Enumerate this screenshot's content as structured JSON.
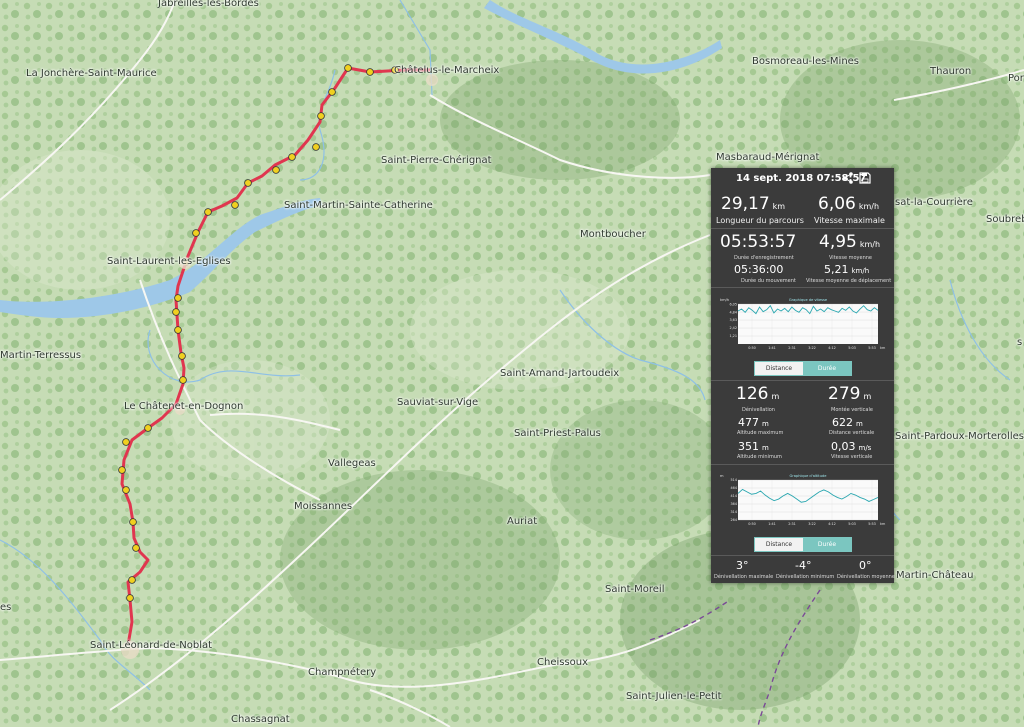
{
  "colors": {
    "map_bg": "#c9ddb9",
    "water": "#8ec0e6",
    "track": "#e0364f",
    "panel_bg": "#3b3b3b",
    "chart_line": "#8fe0e6",
    "accent": "#7bc6c0"
  },
  "places": [
    {
      "id": "jabreilles",
      "name": "Jabreilles-les-Bordes"
    },
    {
      "id": "jonchere",
      "name": "La Jonchère-Saint-Maurice"
    },
    {
      "id": "chatelus",
      "name": "Châtelus-le-Marcheix"
    },
    {
      "id": "bosmoreau",
      "name": "Bosmoreau-les-Mines"
    },
    {
      "id": "thauron",
      "name": "Thauron"
    },
    {
      "id": "por",
      "name": "Por"
    },
    {
      "id": "saint-pierre",
      "name": "Saint-Pierre-Chérignat"
    },
    {
      "id": "masbaraud",
      "name": "Masbaraud-Mérignat"
    },
    {
      "id": "martin-ste-cath",
      "name": "Saint-Martin-Sainte-Catherine"
    },
    {
      "id": "courriere",
      "name": "sat-la-Courrière"
    },
    {
      "id": "soubreb",
      "name": "Soubreb"
    },
    {
      "id": "montboucher",
      "name": "Montboucher"
    },
    {
      "id": "laurent",
      "name": "Saint-Laurent-les-Eglises"
    },
    {
      "id": "terressus",
      "name": "Martin-Terressus"
    },
    {
      "id": "amand",
      "name": "Saint-Amand-Jartoudeix"
    },
    {
      "id": "chatenet",
      "name": "Le Châtenet-en-Dognon"
    },
    {
      "id": "sauviat",
      "name": "Sauviat-sur-Vige"
    },
    {
      "id": "priest",
      "name": "Saint-Priest-Palus"
    },
    {
      "id": "pardoux",
      "name": "Saint-Pardoux-Morterolles"
    },
    {
      "id": "vallegeas",
      "name": "Vallegeas"
    },
    {
      "id": "moissannes",
      "name": "Moissannes"
    },
    {
      "id": "auriat",
      "name": "Auriat"
    },
    {
      "id": "martin-chateau",
      "name": "Martin-Château"
    },
    {
      "id": "moreil",
      "name": "Saint-Moreil"
    },
    {
      "id": "es",
      "name": "es"
    },
    {
      "id": "leonard",
      "name": "Saint-Léonard-de-Noblat"
    },
    {
      "id": "champnetery",
      "name": "Champnétery"
    },
    {
      "id": "cheissoux",
      "name": "Cheissoux"
    },
    {
      "id": "julien",
      "name": "Saint-Julien-le-Petit"
    },
    {
      "id": "chassagnat",
      "name": "Chassagnat"
    },
    {
      "id": "s-edge",
      "name": "s"
    }
  ],
  "panel": {
    "date": "14 sept. 2018 07:58:57",
    "distance": {
      "value": "29,17",
      "unit": "km",
      "label": "Longueur du parcours"
    },
    "max_speed": {
      "value": "6,06",
      "unit": "km/h",
      "label": "Vitesse maximale"
    },
    "duration": {
      "value": "05:53:57",
      "label": "Durée d'enregistrement"
    },
    "avg_speed": {
      "value": "4,95",
      "unit": "km/h",
      "label": "Vitesse moyenne"
    },
    "moving_time": {
      "value": "05:36:00",
      "label": "Durée du mouvement"
    },
    "avg_moving_speed": {
      "value": "5,21",
      "unit": "km/h",
      "label": "Vitesse moyenne de déplacement"
    },
    "elev_gain": {
      "value": "126",
      "unit": "m",
      "label": "Dénivellation"
    },
    "vert_climb": {
      "value": "279",
      "unit": "m",
      "label": "Montée verticale"
    },
    "alt_max": {
      "value": "477",
      "unit": "m",
      "label": "Altitude maximum"
    },
    "vert_dist": {
      "value": "622",
      "unit": "m",
      "label": "Distance verticale"
    },
    "alt_min": {
      "value": "351",
      "unit": "m",
      "label": "Altitude minimum"
    },
    "vert_speed": {
      "value": "0,03",
      "unit": "m/s",
      "label": "Vitesse verticale"
    },
    "slope_max": {
      "value": "3°",
      "label": "Dénivellation maximale"
    },
    "slope_min": {
      "value": "-4°",
      "label": "Dénivellation minimum"
    },
    "slope_avg": {
      "value": "0°",
      "label": "Dénivellation moyenne"
    },
    "toggle": {
      "distance": "Distance",
      "duration": "Durée"
    },
    "icons": [
      "share-icon",
      "save-icon"
    ]
  },
  "chart_data": [
    {
      "type": "line",
      "title": "Graphique de vitesse",
      "ylabel": "km/h",
      "xlabel": "km",
      "yticks": [
        "6,05",
        "4,84",
        "3,63",
        "2,42",
        "1,21"
      ],
      "ylim": [
        0,
        6.06
      ],
      "x": [
        "0:50",
        "1:41",
        "2:31",
        "3:22",
        "4:12",
        "5:03",
        "5:53"
      ],
      "series": [
        {
          "values": [
            5.0,
            5.3,
            4.8,
            5.5,
            5.1,
            4.6,
            5.6,
            4.9,
            5.2,
            5.8,
            4.7,
            5.3,
            5.0,
            5.4,
            4.9,
            5.6,
            5.1,
            4.8,
            5.5,
            5.2,
            4.6,
            5.7,
            5.0,
            5.3,
            4.9,
            5.5,
            5.2,
            5.0,
            4.8,
            5.4,
            5.1,
            5.6,
            5.0,
            4.7,
            5.3,
            5.8,
            5.2,
            5.0,
            5.5,
            5.1
          ]
        }
      ]
    },
    {
      "type": "line",
      "title": "Graphique d'altitude",
      "ylabel": "m",
      "xlabel": "km",
      "yticks": [
        "514",
        "464",
        "414",
        "364",
        "314",
        "264"
      ],
      "ylim": [
        264,
        514
      ],
      "x": [
        "0:50",
        "1:41",
        "2:31",
        "3:22",
        "4:12",
        "5:03",
        "5:53"
      ],
      "series": [
        {
          "values": [
            430,
            455,
            440,
            425,
            430,
            445,
            420,
            400,
            385,
            395,
            415,
            430,
            415,
            395,
            375,
            380,
            400,
            420,
            440,
            452,
            440,
            420,
            405,
            395,
            410,
            430,
            420,
            405,
            395,
            380,
            392,
            405
          ]
        }
      ]
    }
  ]
}
